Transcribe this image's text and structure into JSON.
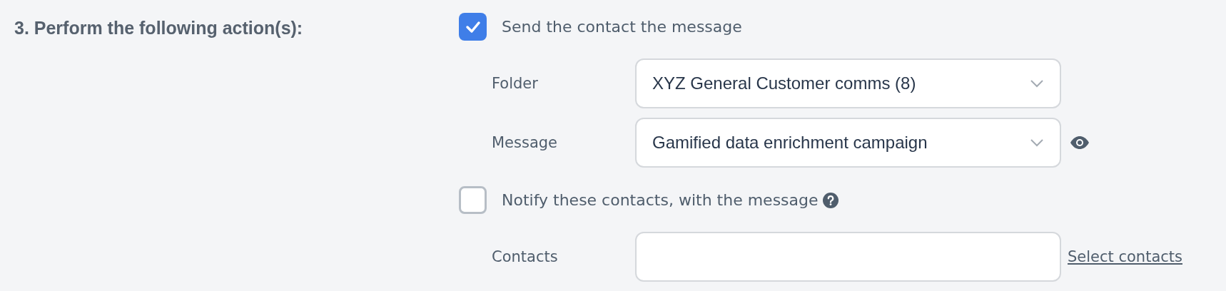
{
  "heading": "3. Perform the following action(s):",
  "actions": [
    {
      "label": "Send the contact the message",
      "checked": true,
      "help": false,
      "fields": [
        {
          "label": "Folder",
          "kind": "select",
          "value": "XYZ General Customer comms (8)",
          "preview": false
        },
        {
          "label": "Message",
          "kind": "select",
          "value": "Gamified data enrichment campaign",
          "preview": true
        }
      ]
    },
    {
      "label": "Notify these contacts, with the message",
      "checked": false,
      "help": true,
      "fields": [
        {
          "label": "Contacts",
          "kind": "text",
          "link": "Select contacts"
        }
      ]
    }
  ]
}
